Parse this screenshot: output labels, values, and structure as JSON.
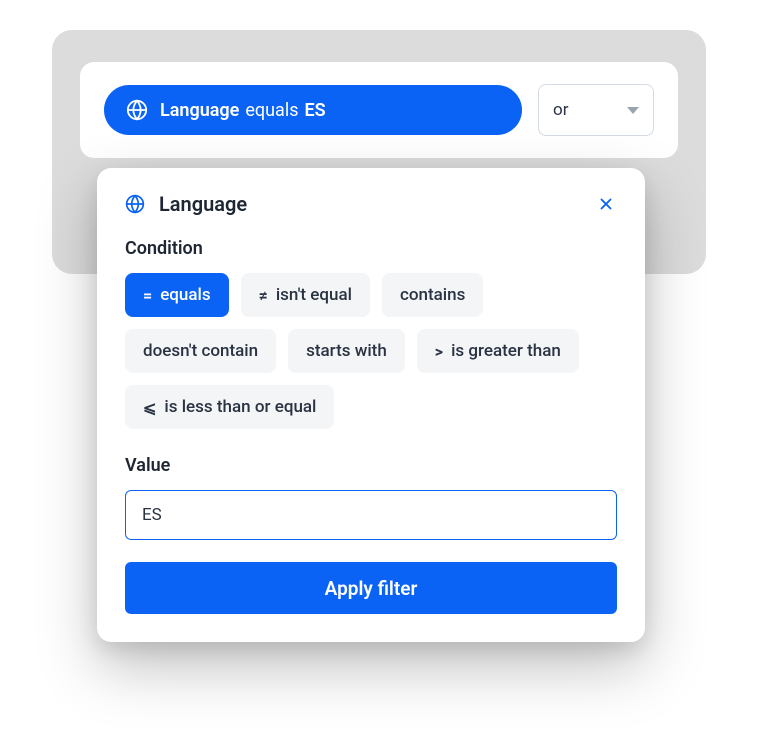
{
  "filterPill": {
    "field": "Language",
    "operator": "equals",
    "value": "ES"
  },
  "logicSelect": {
    "value": "or"
  },
  "popover": {
    "title": "Language",
    "conditionLabel": "Condition",
    "conditions": [
      {
        "symbol": "=",
        "label": "equals",
        "active": true
      },
      {
        "symbol": "≠",
        "label": "isn't equal",
        "active": false
      },
      {
        "symbol": "",
        "label": "contains",
        "active": false
      },
      {
        "symbol": "",
        "label": "doesn't contain",
        "active": false
      },
      {
        "symbol": "",
        "label": "starts with",
        "active": false
      },
      {
        "symbol": ">",
        "label": "is greater than",
        "active": false
      },
      {
        "symbol": "⩽",
        "label": "is less than or equal",
        "active": false
      }
    ],
    "valueLabel": "Value",
    "valueInput": "ES",
    "applyButton": "Apply filter"
  }
}
